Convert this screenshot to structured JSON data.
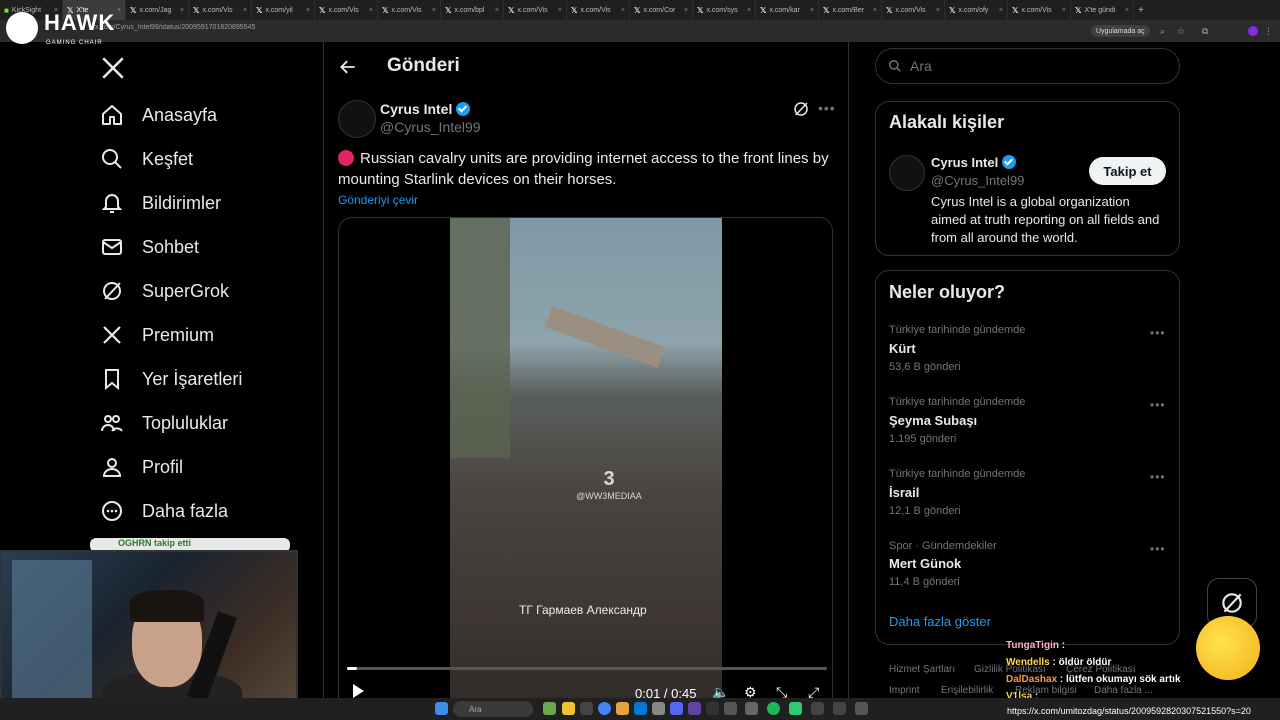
{
  "browser": {
    "tabs": [
      {
        "label": "KickSight",
        "icon": "kick-icon"
      },
      {
        "label": "X'te",
        "icon": "x-icon"
      },
      {
        "label": "x.com/Jag",
        "icon": "x-icon"
      },
      {
        "label": "x.com/Vis",
        "icon": "x-icon"
      },
      {
        "label": "x.com/yil",
        "icon": "x-icon"
      },
      {
        "label": "x.com/Vis",
        "icon": "x-icon"
      },
      {
        "label": "x.com/Vis",
        "icon": "x-icon"
      },
      {
        "label": "x.com/bpl",
        "icon": "x-icon"
      },
      {
        "label": "x.com/Vis",
        "icon": "x-icon"
      },
      {
        "label": "x.com/Vis",
        "icon": "x-icon"
      },
      {
        "label": "x.com/Cor",
        "icon": "x-icon"
      },
      {
        "label": "x.com/sys",
        "icon": "x-icon"
      },
      {
        "label": "x.com/kar",
        "icon": "x-icon"
      },
      {
        "label": "x.com/Ber",
        "icon": "x-icon"
      },
      {
        "label": "x.com/Vis",
        "icon": "x-icon"
      },
      {
        "label": "x.com/ofy",
        "icon": "x-icon"
      },
      {
        "label": "x.com/Vis",
        "icon": "x-icon"
      },
      {
        "label": "X'te gündi",
        "icon": "x-icon"
      }
    ],
    "url": "x.com/Cyrus_Intel99/status/2009591701820895545",
    "app_badge": "Uygulamada aç"
  },
  "stream_logo": {
    "title": "HAWK",
    "subtitle": "GAMING CHAIR"
  },
  "nav": {
    "items": [
      {
        "label": "Anasayfa",
        "icon": "home-icon"
      },
      {
        "label": "Keşfet",
        "icon": "search-icon"
      },
      {
        "label": "Bildirimler",
        "icon": "bell-icon"
      },
      {
        "label": "Sohbet",
        "icon": "envelope-icon"
      },
      {
        "label": "SuperGrok",
        "icon": "grok-icon"
      },
      {
        "label": "Premium",
        "icon": "x-logo-icon"
      },
      {
        "label": "Yer İşaretleri",
        "icon": "bookmark-icon"
      },
      {
        "label": "Topluluklar",
        "icon": "people-icon"
      },
      {
        "label": "Profil",
        "icon": "person-icon"
      },
      {
        "label": "Daha fazla",
        "icon": "more-circle-icon"
      }
    ]
  },
  "main": {
    "title": "Gönderi",
    "post": {
      "author": "Cyrus Intel",
      "handle": "@Cyrus_Intel99",
      "text": "Russian cavalry units are providing internet access to the front lines by mounting Starlink devices on their horses.",
      "translate": "Gönderiyi çevir",
      "video": {
        "watermark": "@WW3MEDIAA",
        "caption": "ТГ Гармаев Александр",
        "time": "0:01 / 0:45",
        "progress": 0.02
      }
    }
  },
  "right": {
    "search_placeholder": "Ara",
    "related": {
      "title": "Alakalı kişiler",
      "name": "Cyrus Intel",
      "handle": "@Cyrus_Intel99",
      "follow": "Takip et",
      "bio": "Cyrus Intel is a global organization aimed at truth reporting on all fields and from all around the world."
    },
    "trends": {
      "title": "Neler oluyor?",
      "items": [
        {
          "context": "Türkiye tarihinde gündemde",
          "name": "Kürt",
          "count": "53,6 B gönderi"
        },
        {
          "context": "Türkiye tarihinde gündemde",
          "name": "Şeyma Subaşı",
          "count": "1.195 gönderi"
        },
        {
          "context": "Türkiye tarihinde gündemde",
          "name": "İsrail",
          "count": "12,1 B gönderi"
        },
        {
          "context": "Spor · Gündemdekiler",
          "name": "Mert Günok",
          "count": "11,4 B gönderi"
        }
      ],
      "show_more": "Daha fazla göster"
    },
    "footer": [
      "Hizmet Şartları",
      "Gizlilik Politikası",
      "Çerez Politikası",
      "Imprint",
      "Erişilebilirlik",
      "Reklam bilgisi",
      "Daha fazla ..."
    ]
  },
  "chat": [
    {
      "user": "TungaTigin",
      "message": ""
    },
    {
      "user": "Wendells",
      "message": "öldür öldür"
    },
    {
      "user": "DalDashax",
      "message": "lütfen okumayı sök artık"
    },
    {
      "user": "V1lsa",
      "message": ""
    }
  ],
  "webcam_notice": "OGHRN takip etti",
  "taskbar": {
    "search": "Ara"
  },
  "status_url": "https://x.com/umitozdag/status/2009592820307521550?s=20"
}
